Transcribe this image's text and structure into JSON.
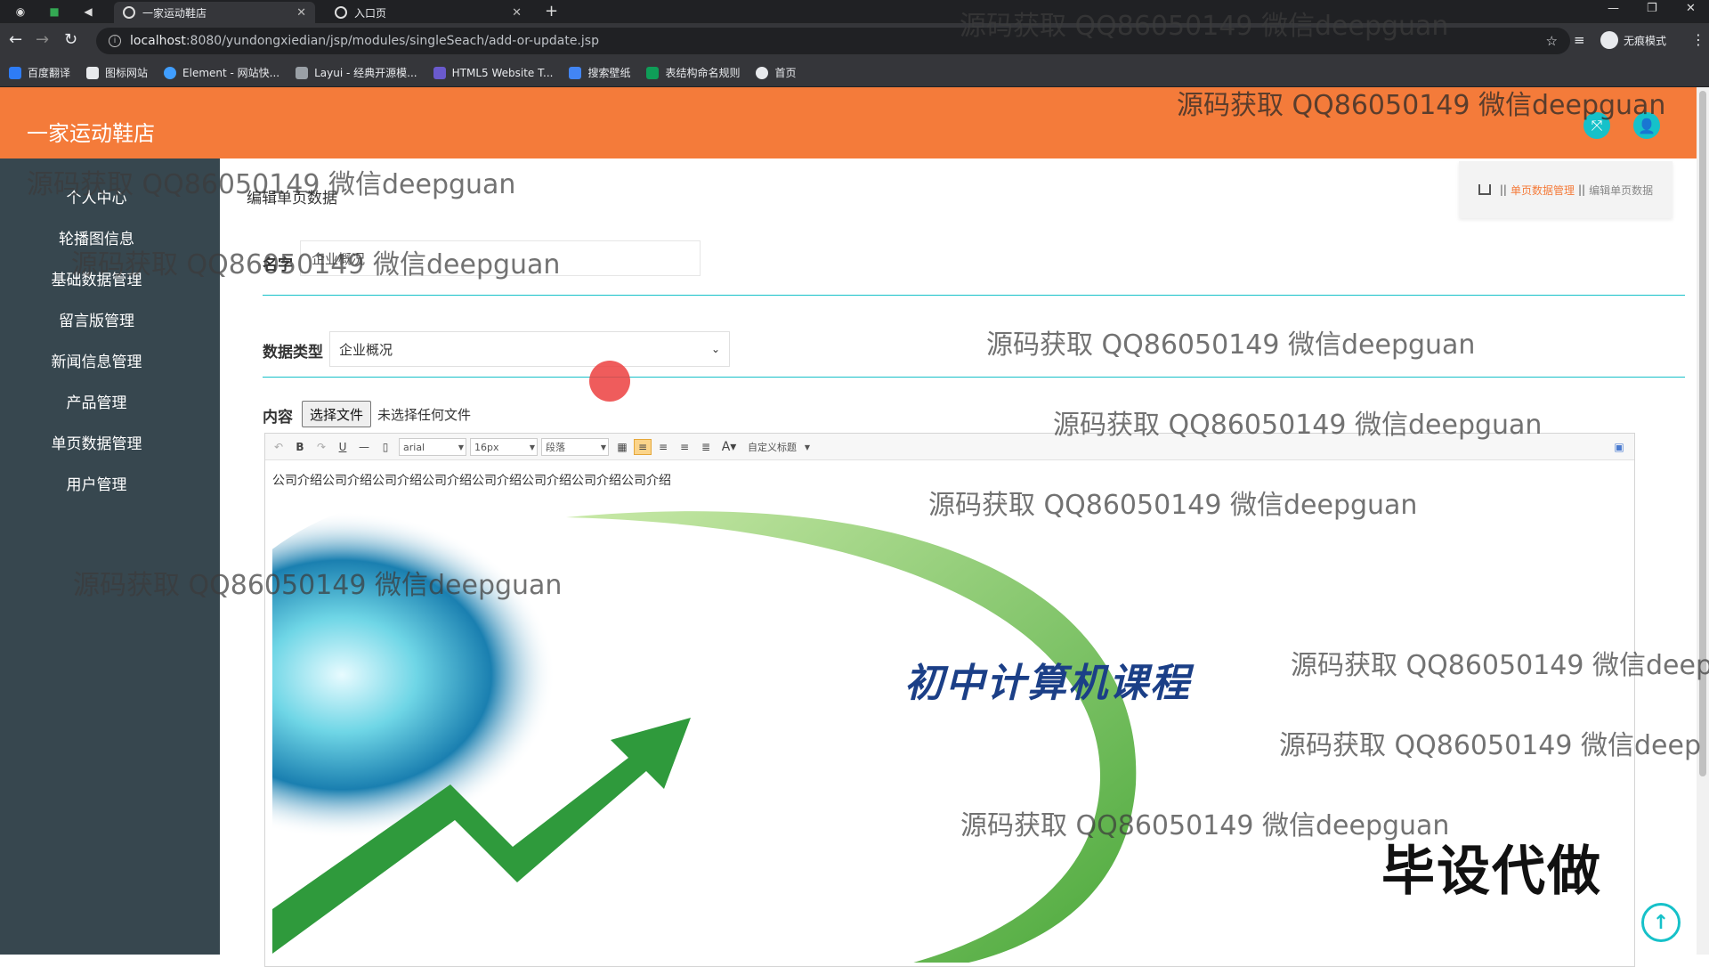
{
  "browser": {
    "tabs": [
      {
        "title": "一家运动鞋店"
      },
      {
        "title": "入口页"
      }
    ],
    "url_host": "localhost",
    "url_rest": ":8080/yundongxiedian/jsp/modules/singleSeach/add-or-update.jsp",
    "profile_label": "无痕模式",
    "bookmarks": [
      "百度翻译",
      "图标网站",
      "Element - 网站快...",
      "Layui - 经典开源模...",
      "HTML5 Website T...",
      "搜索壁纸",
      "表结构命名规则",
      "首页"
    ]
  },
  "app": {
    "title": "一家运动鞋店",
    "colors": {
      "header": "#f47b3a",
      "sidebar": "#37474f",
      "accent": "#16c1c9"
    }
  },
  "sidebar": {
    "items": [
      "个人中心",
      "轮播图信息",
      "基础数据管理",
      "留言版管理",
      "新闻信息管理",
      "产品管理",
      "单页数据管理",
      "用户管理"
    ]
  },
  "page": {
    "heading": "编辑单页数据",
    "breadcrumb": {
      "section": "单页数据管理",
      "current": "编辑单页数据",
      "separator": "||"
    }
  },
  "form": {
    "name_label": "名字",
    "name_value": "企业概况",
    "type_label": "数据类型",
    "type_value": "企业概况",
    "content_label": "内容",
    "file_button": "选择文件",
    "file_status": "未选择任何文件"
  },
  "editor": {
    "font": "arial",
    "size": "16px",
    "paragraph": "段落",
    "custom_title": "自定义标题",
    "text": "公司介绍公司介绍公司介绍公司介绍公司介绍公司介绍公司介绍公司介绍",
    "image_caption": "初中计算机课程"
  },
  "watermark": "源码获取 QQ86050149 微信deepguan",
  "watermark_partial": "源码获取 QQ86050149 微信deep",
  "stamp": "毕设代做"
}
